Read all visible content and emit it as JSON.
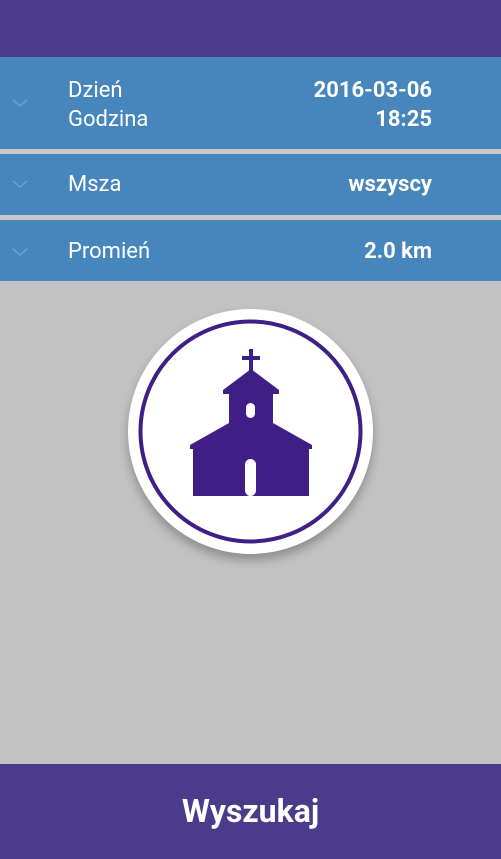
{
  "filters": {
    "date_label": "Dzień",
    "date_value": "2016-03-06",
    "time_label": "Godzina",
    "time_value": "18:25",
    "mass_label": "Msza",
    "mass_value": "wszyscy",
    "radius_label": "Promień",
    "radius_value": "2.0 km"
  },
  "search_button_label": "Wyszukaj",
  "icons": {
    "expand": "chevron-down-icon",
    "logo": "church-icon"
  },
  "colors": {
    "header": "#4a3b8b",
    "filter_row": "#4786bd",
    "background": "#c2c2c2",
    "logo": "#3f1f86"
  }
}
